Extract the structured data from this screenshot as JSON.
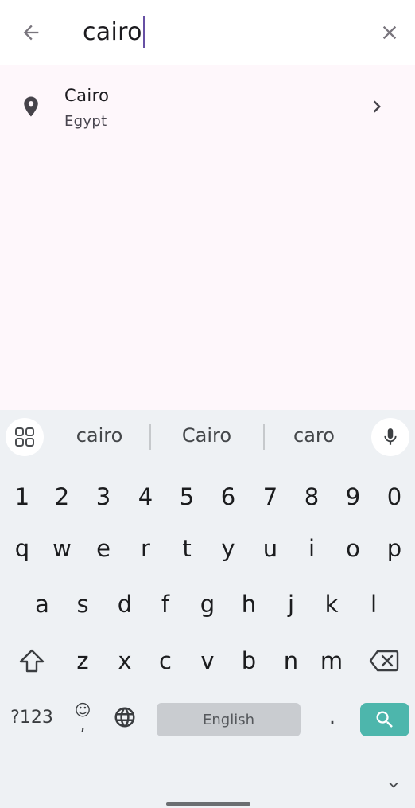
{
  "search": {
    "query": "cairo",
    "back_icon": "arrow-back-icon",
    "clear_icon": "close-icon"
  },
  "results": [
    {
      "title": "Cairo",
      "subtitle": "Egypt",
      "icon": "location-pin-icon",
      "action_icon": "chevron-right-icon"
    }
  ],
  "keyboard": {
    "suggestions": [
      "cairo",
      "Cairo",
      "caro"
    ],
    "number_row": [
      "1",
      "2",
      "3",
      "4",
      "5",
      "6",
      "7",
      "8",
      "9",
      "0"
    ],
    "row_q": [
      "q",
      "w",
      "e",
      "r",
      "t",
      "y",
      "u",
      "i",
      "o",
      "p"
    ],
    "row_a": [
      "a",
      "s",
      "d",
      "f",
      "g",
      "h",
      "j",
      "k",
      "l"
    ],
    "row_z": [
      "z",
      "x",
      "c",
      "v",
      "b",
      "n",
      "m"
    ],
    "symbols_label": "?123",
    "emoji_top": "☺",
    "emoji_bottom": ",",
    "space_label": "English",
    "period_label": "."
  },
  "colors": {
    "accent": "#6750a4",
    "results_bg": "#fef7fb",
    "keyboard_bg": "#eef1f4",
    "search_key": "#4db6ac"
  }
}
